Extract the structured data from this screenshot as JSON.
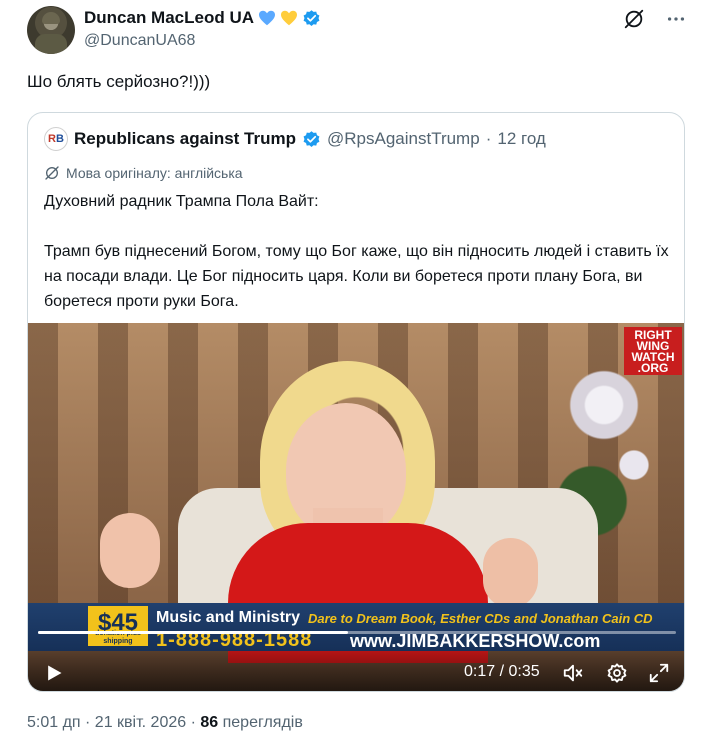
{
  "post": {
    "author_name": "Duncan MacLeod UA",
    "author_handle": "@DuncanUA68",
    "text": "Шо блять серйозно?!)))",
    "timestamp": "5:01 дп · 21 квіт. 2026 · ",
    "views_count": "86",
    "views_label": " переглядів"
  },
  "quote": {
    "author_name": "Republicans against Trump",
    "author_handle": "@RpsAgainstTrump",
    "separator": " · ",
    "time": "12 год",
    "avatar_letter_r": "R",
    "avatar_letter_b": "B",
    "translated_label": "Мова оригіналу: англійська",
    "paragraph_1": "Духовний радник Трампа Пола Вайт:",
    "paragraph_2": "Трамп був піднесений Богом, тому що Бог каже, що він підносить людей і ставить їх на посади влади. Це Бог підносить царя. Коли ви боретеся проти плану Бога, ви боретеся проти руки Бога."
  },
  "video": {
    "logo_line1": "RIGHT",
    "logo_line2": "WING",
    "logo_line3": "WATCH",
    "logo_line4": ".ORG",
    "ticker_price": "$45",
    "ticker_price_note": "donation plus shipping",
    "ticker_title": "Music and Ministry",
    "ticker_subtitle": "Dare to Dream Book, Esther CDs and Jonathan Cain CD",
    "ticker_phone": "1-888-988-1588",
    "ticker_url": "www.JIMBAKKERSHOW.com",
    "current_time": "0:17",
    "time_separator": " / ",
    "duration": "0:35",
    "progress": 0.486
  },
  "icons": {
    "grok": "grok-icon",
    "more": "more-icon",
    "verified": "verified-badge-icon",
    "heart_blue": "blue-heart-icon",
    "heart_yellow": "yellow-heart-icon",
    "translate": "translate-icon",
    "play": "play-icon",
    "volume": "volume-icon",
    "settings": "settings-icon",
    "fullscreen": "fullscreen-icon"
  },
  "colors": {
    "verified": "#1d9bf0",
    "heart_blue": "#5aa9ff",
    "heart_yellow": "#ffcd3c",
    "secondary_text": "#536471",
    "border": "#cfd9de"
  }
}
